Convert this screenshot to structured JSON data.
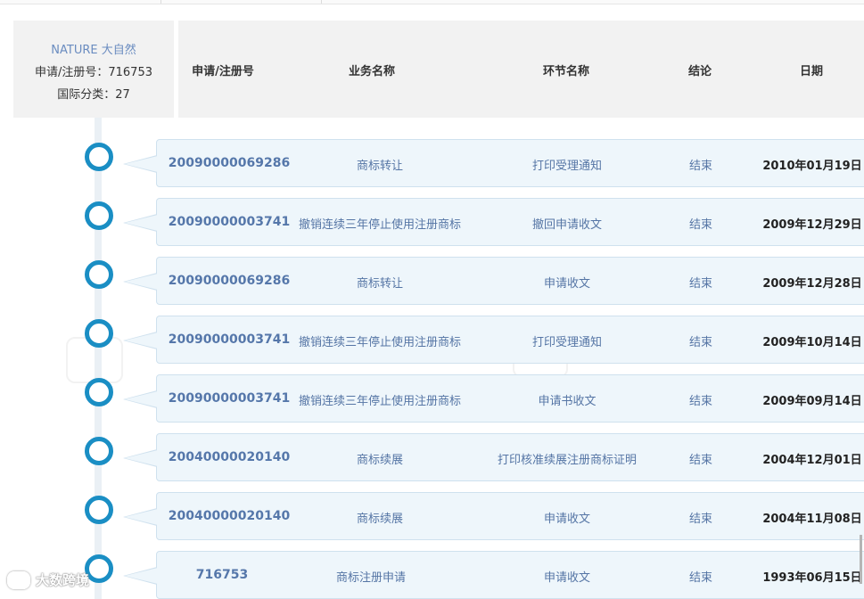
{
  "info": {
    "name": "NATURE 大自然",
    "reg_line": "申请/注册号：716753",
    "class_line": "国际分类：27"
  },
  "columns": {
    "reg_no": "申请/注册号",
    "business": "业务名称",
    "step": "环节名称",
    "result": "结论",
    "date": "日期"
  },
  "rows": [
    {
      "reg_no": "20090000069286",
      "business": "商标转让",
      "step": "打印受理通知",
      "result": "结束",
      "date": "2010年01月19日"
    },
    {
      "reg_no": "20090000003741",
      "business": "撤销连续三年停止使用注册商标",
      "step": "撤回申请收文",
      "result": "结束",
      "date": "2009年12月29日"
    },
    {
      "reg_no": "20090000069286",
      "business": "商标转让",
      "step": "申请收文",
      "result": "结束",
      "date": "2009年12月28日"
    },
    {
      "reg_no": "20090000003741",
      "business": "撤销连续三年停止使用注册商标",
      "step": "打印受理通知",
      "result": "结束",
      "date": "2009年10月14日"
    },
    {
      "reg_no": "20090000003741",
      "business": "撤销连续三年停止使用注册商标",
      "step": "申请书收文",
      "result": "结束",
      "date": "2009年09月14日"
    },
    {
      "reg_no": "20040000020140",
      "business": "商标续展",
      "step": "打印核准续展注册商标证明",
      "result": "结束",
      "date": "2004年12月01日"
    },
    {
      "reg_no": "20040000020140",
      "business": "商标续展",
      "step": "申请收文",
      "result": "结束",
      "date": "2004年11月08日"
    },
    {
      "reg_no": "716753",
      "business": "商标注册申请",
      "step": "申请收文",
      "result": "结束",
      "date": "1993年06月15日"
    }
  ],
  "watermark": "大数跨境",
  "colors": {
    "accent": "#1a8ec4",
    "row_bg": "#eef6fb",
    "header_bg": "#f2f2f2"
  }
}
